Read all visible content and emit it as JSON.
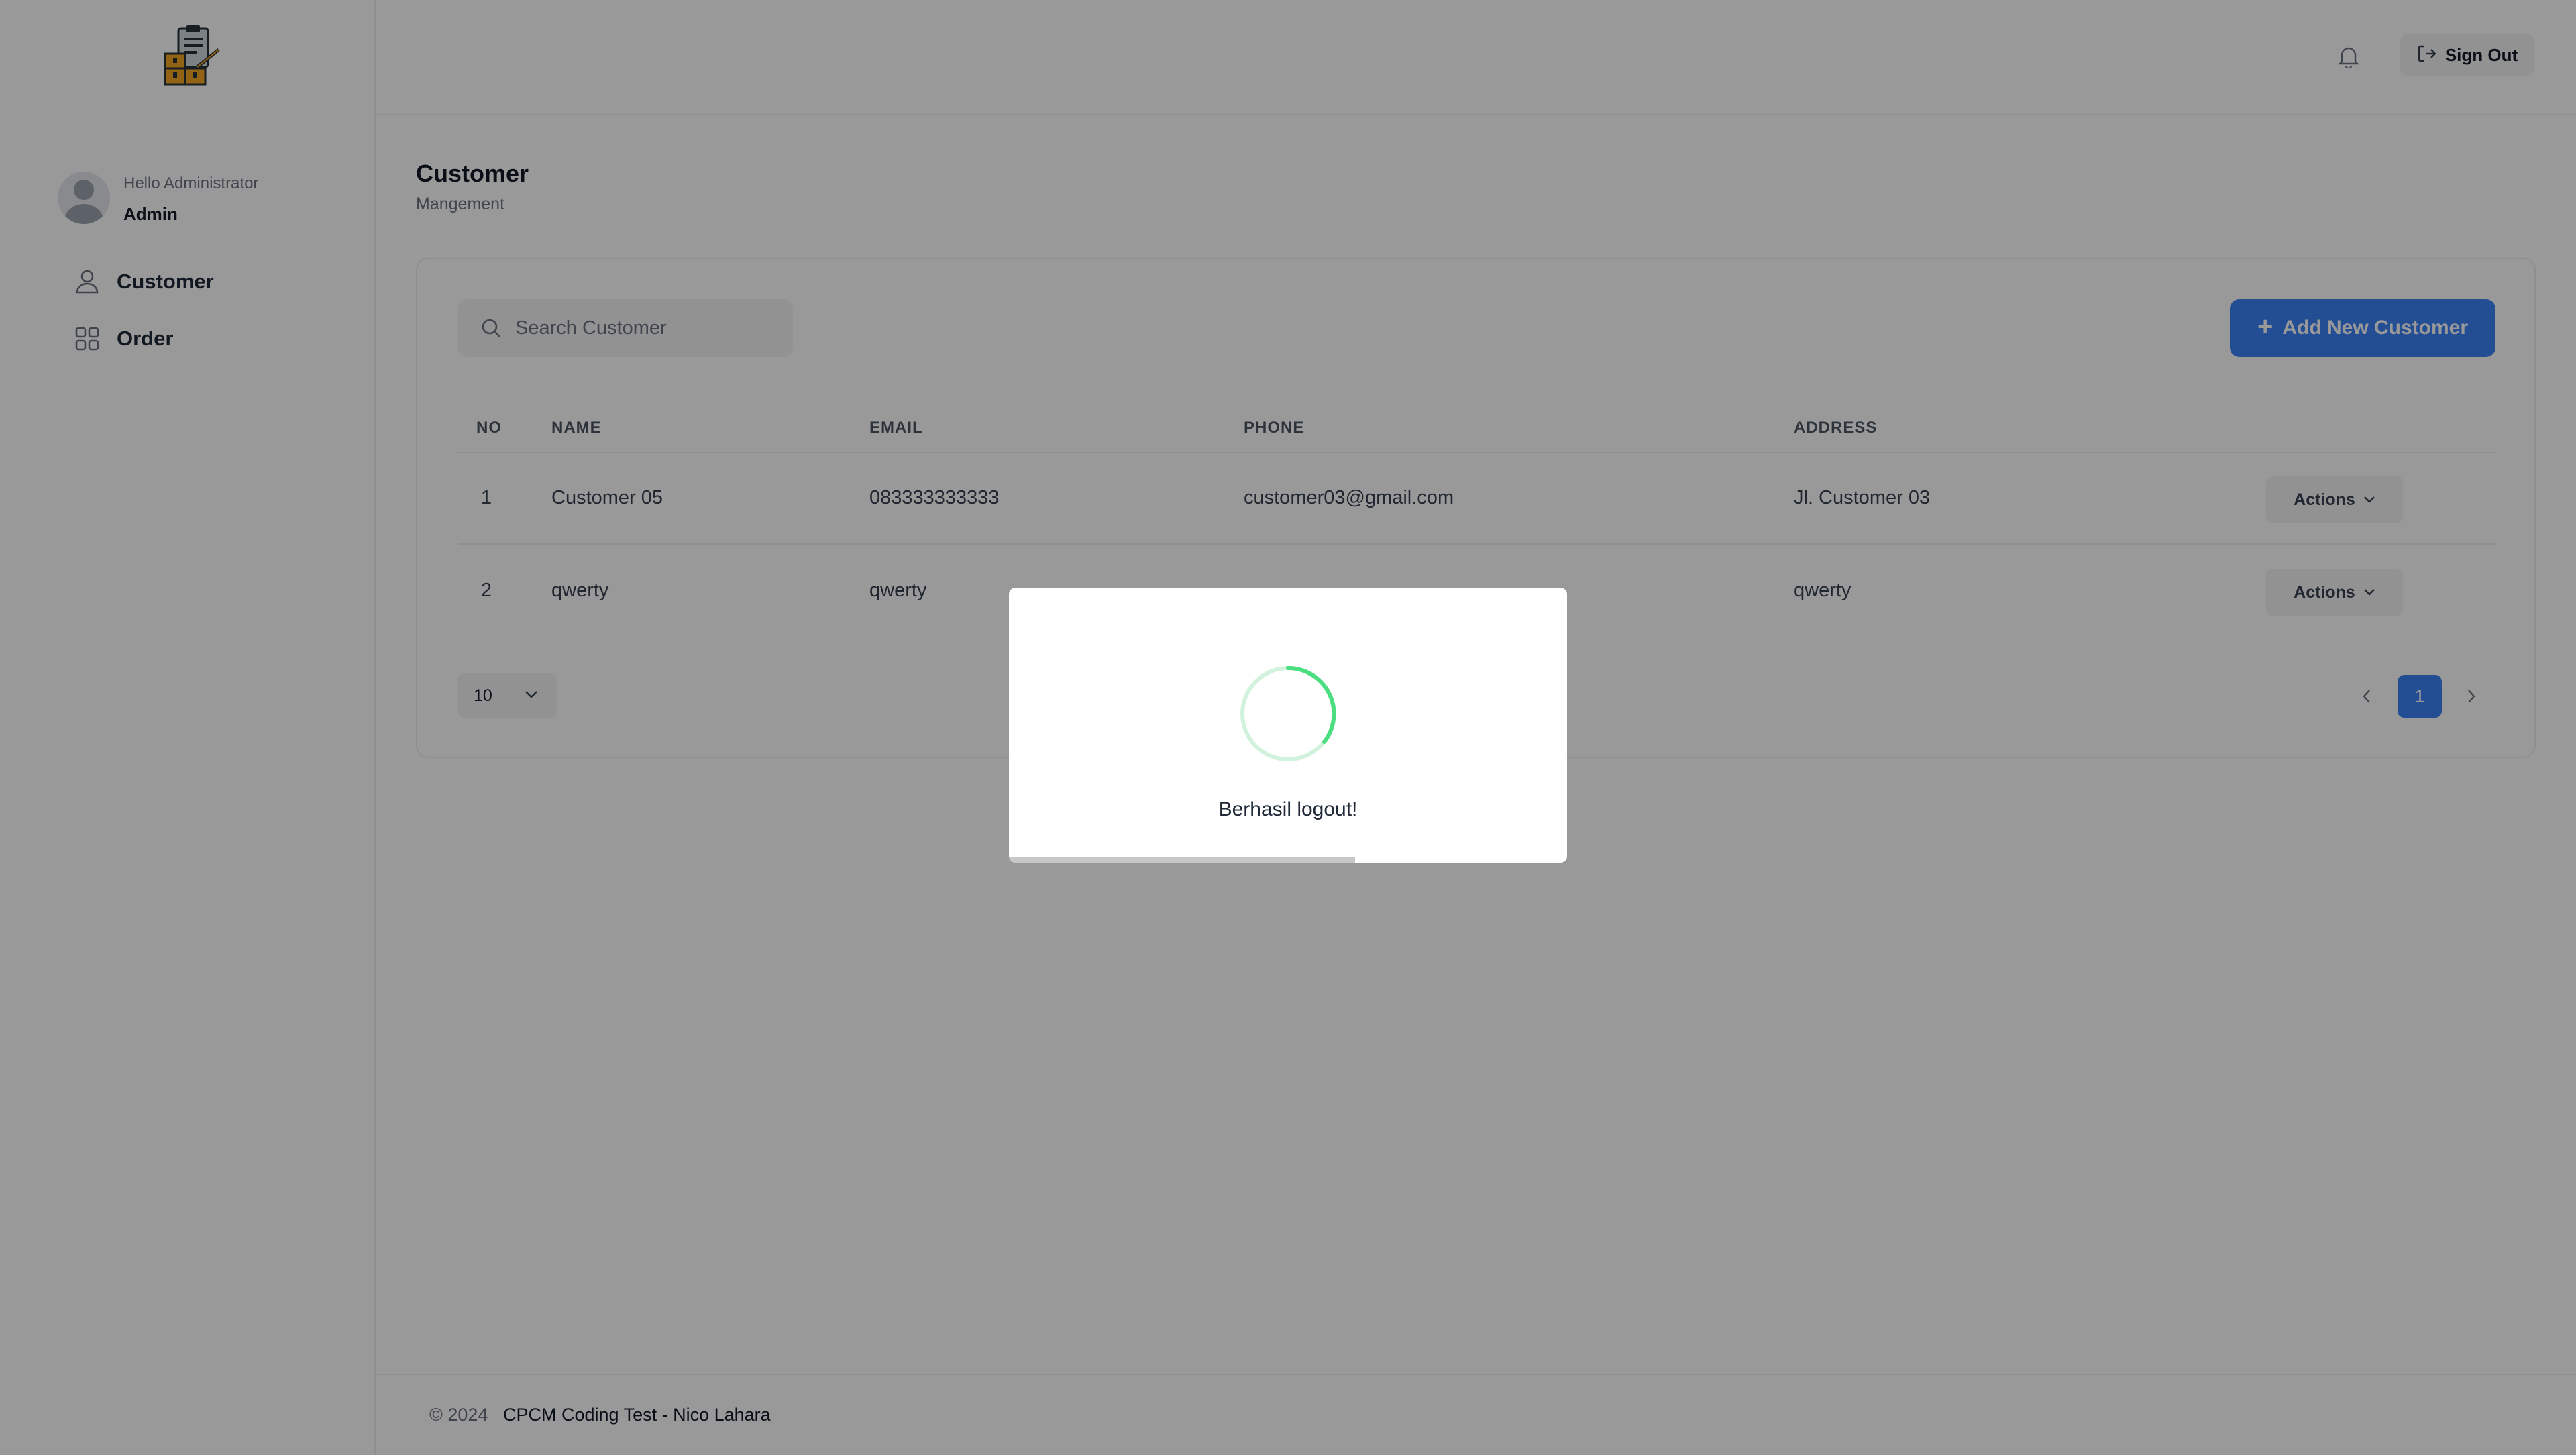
{
  "sidebar": {
    "greeting": "Hello Administrator",
    "role": "Admin",
    "items": [
      {
        "label": "Customer",
        "icon": "user-icon"
      },
      {
        "label": "Order",
        "icon": "grid-icon"
      }
    ]
  },
  "header": {
    "signout_label": "Sign Out",
    "bell_icon": "bell-icon"
  },
  "page": {
    "title": "Customer",
    "subtitle": "Mangement"
  },
  "search": {
    "placeholder": "Search Customer",
    "value": ""
  },
  "add_button_label": "Add New Customer",
  "table": {
    "columns": [
      "NO",
      "NAME",
      "EMAIL",
      "PHONE",
      "ADDRESS"
    ],
    "rows": [
      {
        "no": "1",
        "name": "Customer 05",
        "email": "083333333333",
        "phone": "customer03@gmail.com",
        "address": "Jl. Customer 03",
        "action": "Actions"
      },
      {
        "no": "2",
        "name": "qwerty",
        "email": "qwerty",
        "phone": "",
        "address": "qwerty",
        "action": "Actions"
      }
    ]
  },
  "pagination": {
    "per_page": "10",
    "current_page": "1"
  },
  "footer": {
    "copyright": "© 2024",
    "credit": "CPCM Coding Test - Nico Lahara"
  },
  "modal": {
    "message": "Berhasil logout!",
    "progress": 0.62,
    "icon": "loading-spinner-icon"
  },
  "colors": {
    "accent": "#3b82f6",
    "spinner": "#4ade80",
    "overlay": "rgba(0,0,0,0.40)"
  }
}
